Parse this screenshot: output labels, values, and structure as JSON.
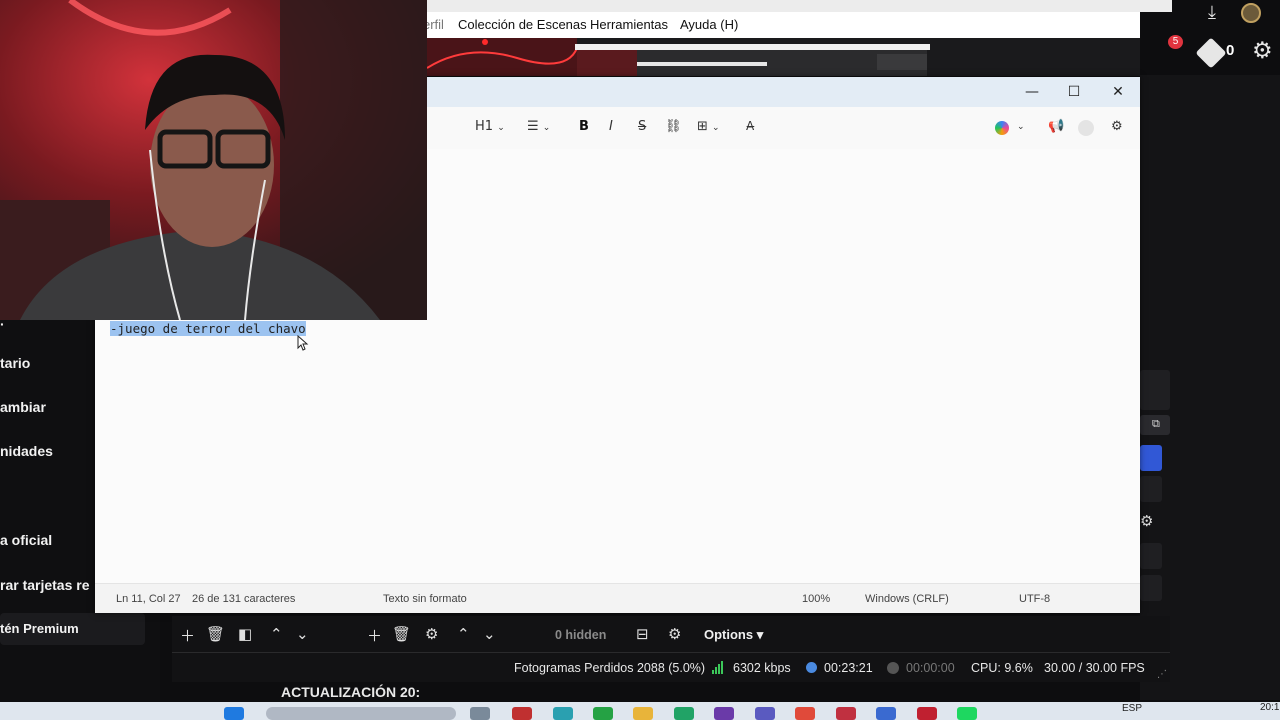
{
  "obs": {
    "menu": [
      "erfil",
      "Colección de Escenas",
      "Herramientas",
      "Ayuda (H)"
    ],
    "notification_count": "5",
    "points": "0"
  },
  "sidebar": {
    "items": [
      "tario",
      "ambiar",
      "nidades",
      "a oficial",
      "rar tarjetas re",
      "tén Premium"
    ]
  },
  "notepad": {
    "toolbar": {
      "heading": "H1",
      "bold": "B",
      "italic": "I",
      "strike": "S"
    },
    "text": "-juego de terror del chavo",
    "status": {
      "position": "Ln 11, Col 27",
      "chars": "26 de 131 caracteres",
      "format": "Texto sin formato",
      "zoom": "100%",
      "line_ending": "Windows (CRLF)",
      "encoding": "UTF-8"
    }
  },
  "controls": {
    "hidden": "0 hidden",
    "options": "Options"
  },
  "statusbar": {
    "dropped": "Fotogramas Perdidos 2088 (5.0%)",
    "bitrate": "6302 kbps",
    "stream_time": "00:23:21",
    "rec_time": "00:00:00",
    "cpu": "CPU: 9.6%",
    "fps": "30.00 / 30.00 FPS"
  },
  "update_text": "ACTUALIZACIÓN 20:",
  "taskbar": {
    "lang": "ESP",
    "clock": "20:1"
  },
  "colors": {
    "selection": "#9cc3f0",
    "webcam_red": "#c0262f",
    "bitrate_green": "#3cc85a"
  }
}
